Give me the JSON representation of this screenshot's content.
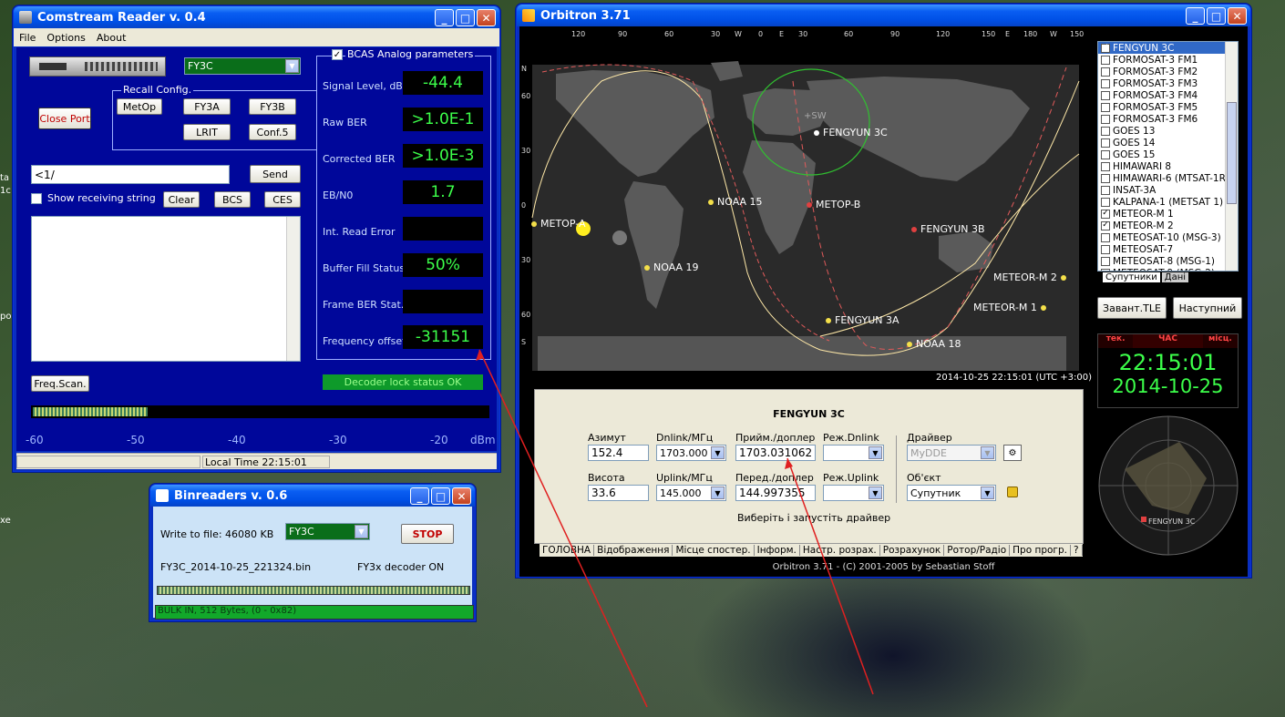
{
  "desktop": {
    "left_edge_labels": [
      "ta",
      "1c",
      "xe",
      "po"
    ]
  },
  "comstream": {
    "title": "Comstream Reader v. 0.4",
    "menu": [
      "File",
      "Options",
      "About"
    ],
    "device_select": "FY3C",
    "recall_title": "Recall Config.",
    "recall_buttons": [
      "MetOp",
      "FY3A",
      "FY3B",
      "LRIT",
      "Conf.5"
    ],
    "close_port": "Close Port",
    "command_input": "<1/",
    "send": "Send",
    "show_receiving": "Show receiving string",
    "clear": "Clear",
    "bcs": "BCS",
    "ces": "CES",
    "bcas_title": "BCAS Analog parameters",
    "params": [
      {
        "label": "Signal Level, dBm",
        "value": "-44.4"
      },
      {
        "label": "Raw BER",
        "value": ">1.0E-1"
      },
      {
        "label": "Corrected BER",
        "value": ">1.0E-3"
      },
      {
        "label": "EB/N0",
        "value": "1.7"
      },
      {
        "label": "Int. Read Error",
        "value": ""
      },
      {
        "label": "Buffer Fill Status",
        "value": "50%"
      },
      {
        "label": "Frame BER Stat.",
        "value": ""
      },
      {
        "label": "Frequency offset",
        "value": "-31151"
      }
    ],
    "freq_scan": "Freq.Scan.",
    "decoder_status": "Decoder lock status OK",
    "meter_level": 0.25,
    "scale": [
      "-60",
      "-50",
      "-40",
      "-30",
      "-20",
      "dBm"
    ],
    "status_time": "Local Time  22:15:01"
  },
  "binreaders": {
    "title": "Binreaders v. 0.6",
    "write_label": "Write to file: 46080 KB",
    "select": "FY3C",
    "stop": "STOP",
    "filename": "FY3C_2014-10-25_221324.bin",
    "decoder": "FY3x decoder ON",
    "status": "BULK IN,     512 Bytes,   (0 - 0x82)"
  },
  "orbitron": {
    "title": "Orbitron 3.71",
    "top_scale": [
      "120",
      "90",
      "60",
      "30",
      "W",
      "0",
      "E",
      "30",
      "60",
      "90",
      "120",
      "150",
      "E",
      "180",
      "W",
      "150"
    ],
    "left_scale": [
      "N",
      "60",
      "30",
      "0",
      "30",
      "60",
      "S"
    ],
    "satellites": [
      {
        "name": "FENGYUN 3C",
        "color": "w"
      },
      {
        "name": "METOP-B",
        "color": "r"
      },
      {
        "name": "FENGYUN 3B",
        "color": "r"
      },
      {
        "name": "NOAA 15",
        "color": "y"
      },
      {
        "name": "METOP-A",
        "color": "y"
      },
      {
        "name": "NOAA 19",
        "color": "y"
      },
      {
        "name": "FENGYUN 3A",
        "color": "y"
      },
      {
        "name": "NOAA 18",
        "color": "y"
      },
      {
        "name": "METEOR-M 2",
        "color": "y"
      },
      {
        "name": "METEOR-M 1",
        "color": "y"
      }
    ],
    "qth_label": "+SW",
    "map_time": "2014-10-25 22:15:01 (UTC +3:00)",
    "sat_list": [
      {
        "name": "FENGYUN 3C",
        "checked": true
      },
      {
        "name": "FORMOSAT-3 FM1",
        "checked": false
      },
      {
        "name": "FORMOSAT-3 FM2",
        "checked": false
      },
      {
        "name": "FORMOSAT-3 FM3",
        "checked": false
      },
      {
        "name": "FORMOSAT-3 FM4",
        "checked": false
      },
      {
        "name": "FORMOSAT-3 FM5",
        "checked": false
      },
      {
        "name": "FORMOSAT-3 FM6",
        "checked": false
      },
      {
        "name": "GOES 13",
        "checked": false
      },
      {
        "name": "GOES 14",
        "checked": false
      },
      {
        "name": "GOES 15",
        "checked": false
      },
      {
        "name": "HIMAWARI 8",
        "checked": false
      },
      {
        "name": "HIMAWARI-6 (MTSAT-1R",
        "checked": false
      },
      {
        "name": "INSAT-3A",
        "checked": false
      },
      {
        "name": "KALPANA-1 (METSAT 1)",
        "checked": false
      },
      {
        "name": "METEOR-M 1",
        "checked": true
      },
      {
        "name": "METEOR-M 2",
        "checked": true
      },
      {
        "name": "METEOSAT-10 (MSG-3)",
        "checked": false
      },
      {
        "name": "METEOSAT-7",
        "checked": false
      },
      {
        "name": "METEOSAT-8 (MSG-1)",
        "checked": false
      },
      {
        "name": "METEOSAT-9 (MSG-2)",
        "checked": false
      }
    ],
    "list_tabs": [
      "Супутники",
      "Дані"
    ],
    "load_tle": "Завант.TLE",
    "next": "Наступний",
    "clock_tabs": [
      "тек.",
      "ЧАС",
      "місц."
    ],
    "clock_time": "22:15:01",
    "clock_date": "2014-10-25",
    "radar_label": "FENGYUN 3C",
    "info_title": "FENGYUN 3C",
    "fields": {
      "az_label": "Азимут",
      "az": "152.4",
      "dn_label": "Dnlink/МГц",
      "dn": "1703.000",
      "rx_label": "Прийм./доплер",
      "rx": "1703.031062",
      "mdn_label": "Реж.Dnlink",
      "mdn": "",
      "drv_label": "Драйвер",
      "drv": "MyDDE",
      "el_label": "Висота",
      "el": "33.6",
      "up_label": "Uplink/МГц",
      "up": "145.000",
      "tx_label": "Перед./доплер",
      "tx": "144.997355",
      "mup_label": "Реж.Uplink",
      "mup": "",
      "obj_label": "Об'єкт",
      "obj": "Супутник"
    },
    "driver_hint": "Виберіть і запустіть драйвер",
    "tabs": [
      "ГОЛОВНА",
      "Відображення",
      "Місце спостер.",
      "Інформ.",
      "Настр. розрах.",
      "Розрахунок",
      "Ротор/Радіо",
      "Про прогр.",
      "?"
    ],
    "status": "Orbitron 3.71 - (C) 2001-2005 by Sebastian Stoff"
  }
}
